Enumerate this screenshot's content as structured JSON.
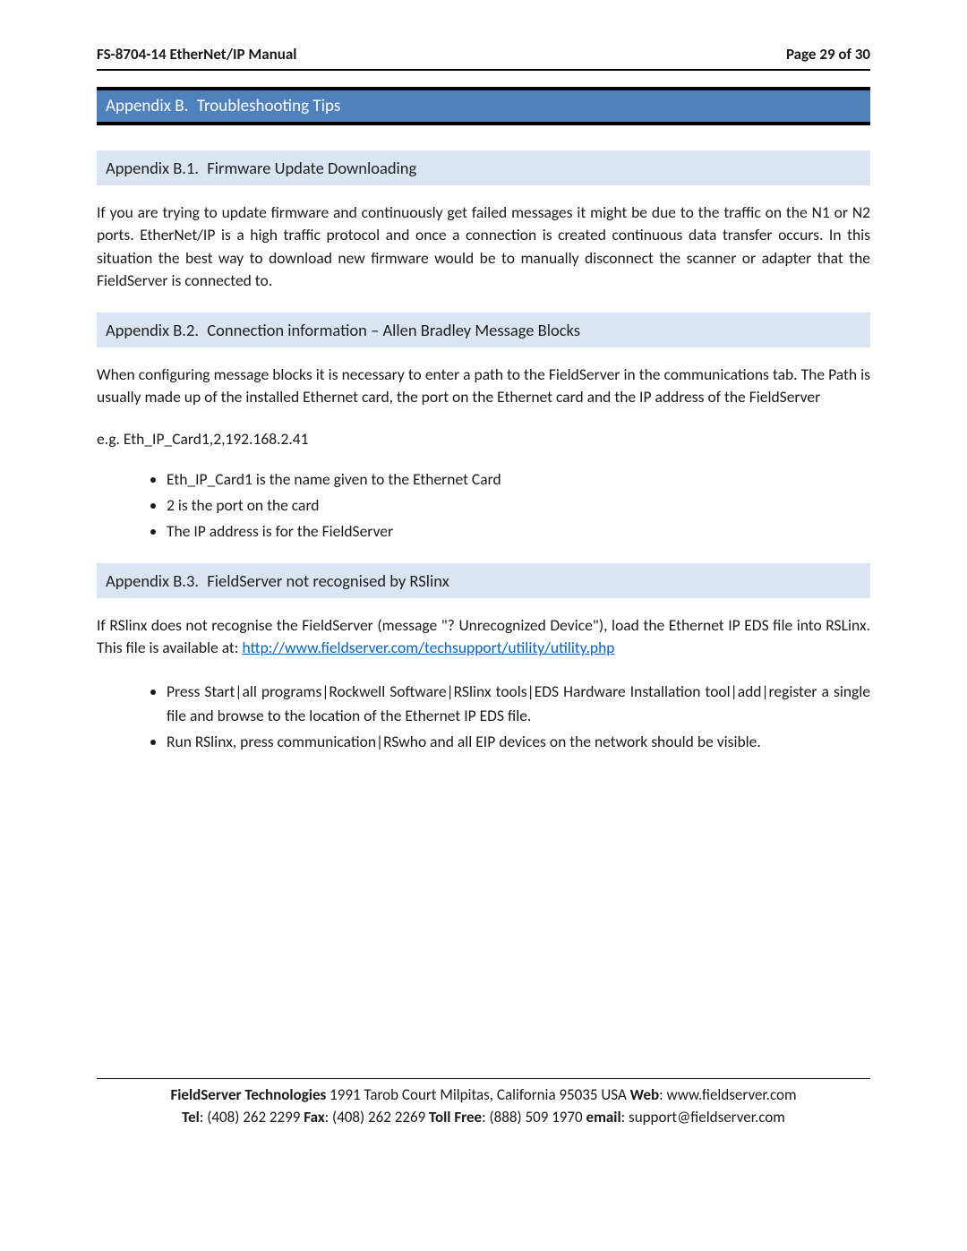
{
  "header": {
    "doc_title": "FS-8704-14 EtherNet/IP Manual",
    "page_label": "Page 29 of 30"
  },
  "appendix": {
    "title": "Appendix B. Troubleshooting Tips"
  },
  "sections": {
    "b1": {
      "heading": "Appendix B.1. Firmware Update Downloading",
      "para": "If you are trying to update firmware and continuously get failed messages it might be due to the traffic on the N1 or N2 ports.  EtherNet/IP is a high traffic protocol and once a connection is created continuous data transfer occurs.  In this situation the best way to download new firmware would be to manually disconnect the scanner or adapter that the FieldServer is connected to."
    },
    "b2": {
      "heading": "Appendix B.2. Connection information – Allen Bradley Message Blocks",
      "para1": "When configuring message blocks it is necessary to enter a path to the FieldServer in the communications tab.  The Path is usually made up of the installed Ethernet card, the port on the Ethernet card and the IP address of the FieldServer",
      "example": " e.g. Eth_IP_Card1,2,192.168.2.41",
      "bullets": [
        "Eth_IP_Card1 is the name given to the Ethernet Card",
        "2 is the port on the card",
        "The IP address is for the FieldServer"
      ]
    },
    "b3": {
      "heading": "Appendix B.3. FieldServer not recognised by RSlinx",
      "para_pre": "If RSlinx does not recognise the FieldServer (message \"? Unrecognized Device\"), load the Ethernet IP EDS file into RSLinx.  This file is available at:  ",
      "link_text": "http://www.fieldserver.com/techsupport/utility/utility.php",
      "bullets": [
        "Press Start|all programs|Rockwell Software|RSlinx tools|EDS Hardware Installation tool|add|register a single file and browse to the location of the Ethernet IP EDS file.",
        "Run RSlinx, press communication|RSwho and all EIP devices on the network should be visible."
      ]
    }
  },
  "footer": {
    "company": "FieldServer Technologies",
    "address": " 1991 Tarob Court Milpitas, California 95035 USA   ",
    "web_label": "Web",
    "web": ": www.fieldserver.com",
    "tel_label": "Tel",
    "tel": ": (408) 262 2299   ",
    "fax_label": "Fax",
    "fax": ": (408) 262 2269   ",
    "tollfree_label": "Toll Free",
    "tollfree": ": (888) 509 1970   ",
    "email_label": "email",
    "email": ": support@fieldserver.com"
  }
}
